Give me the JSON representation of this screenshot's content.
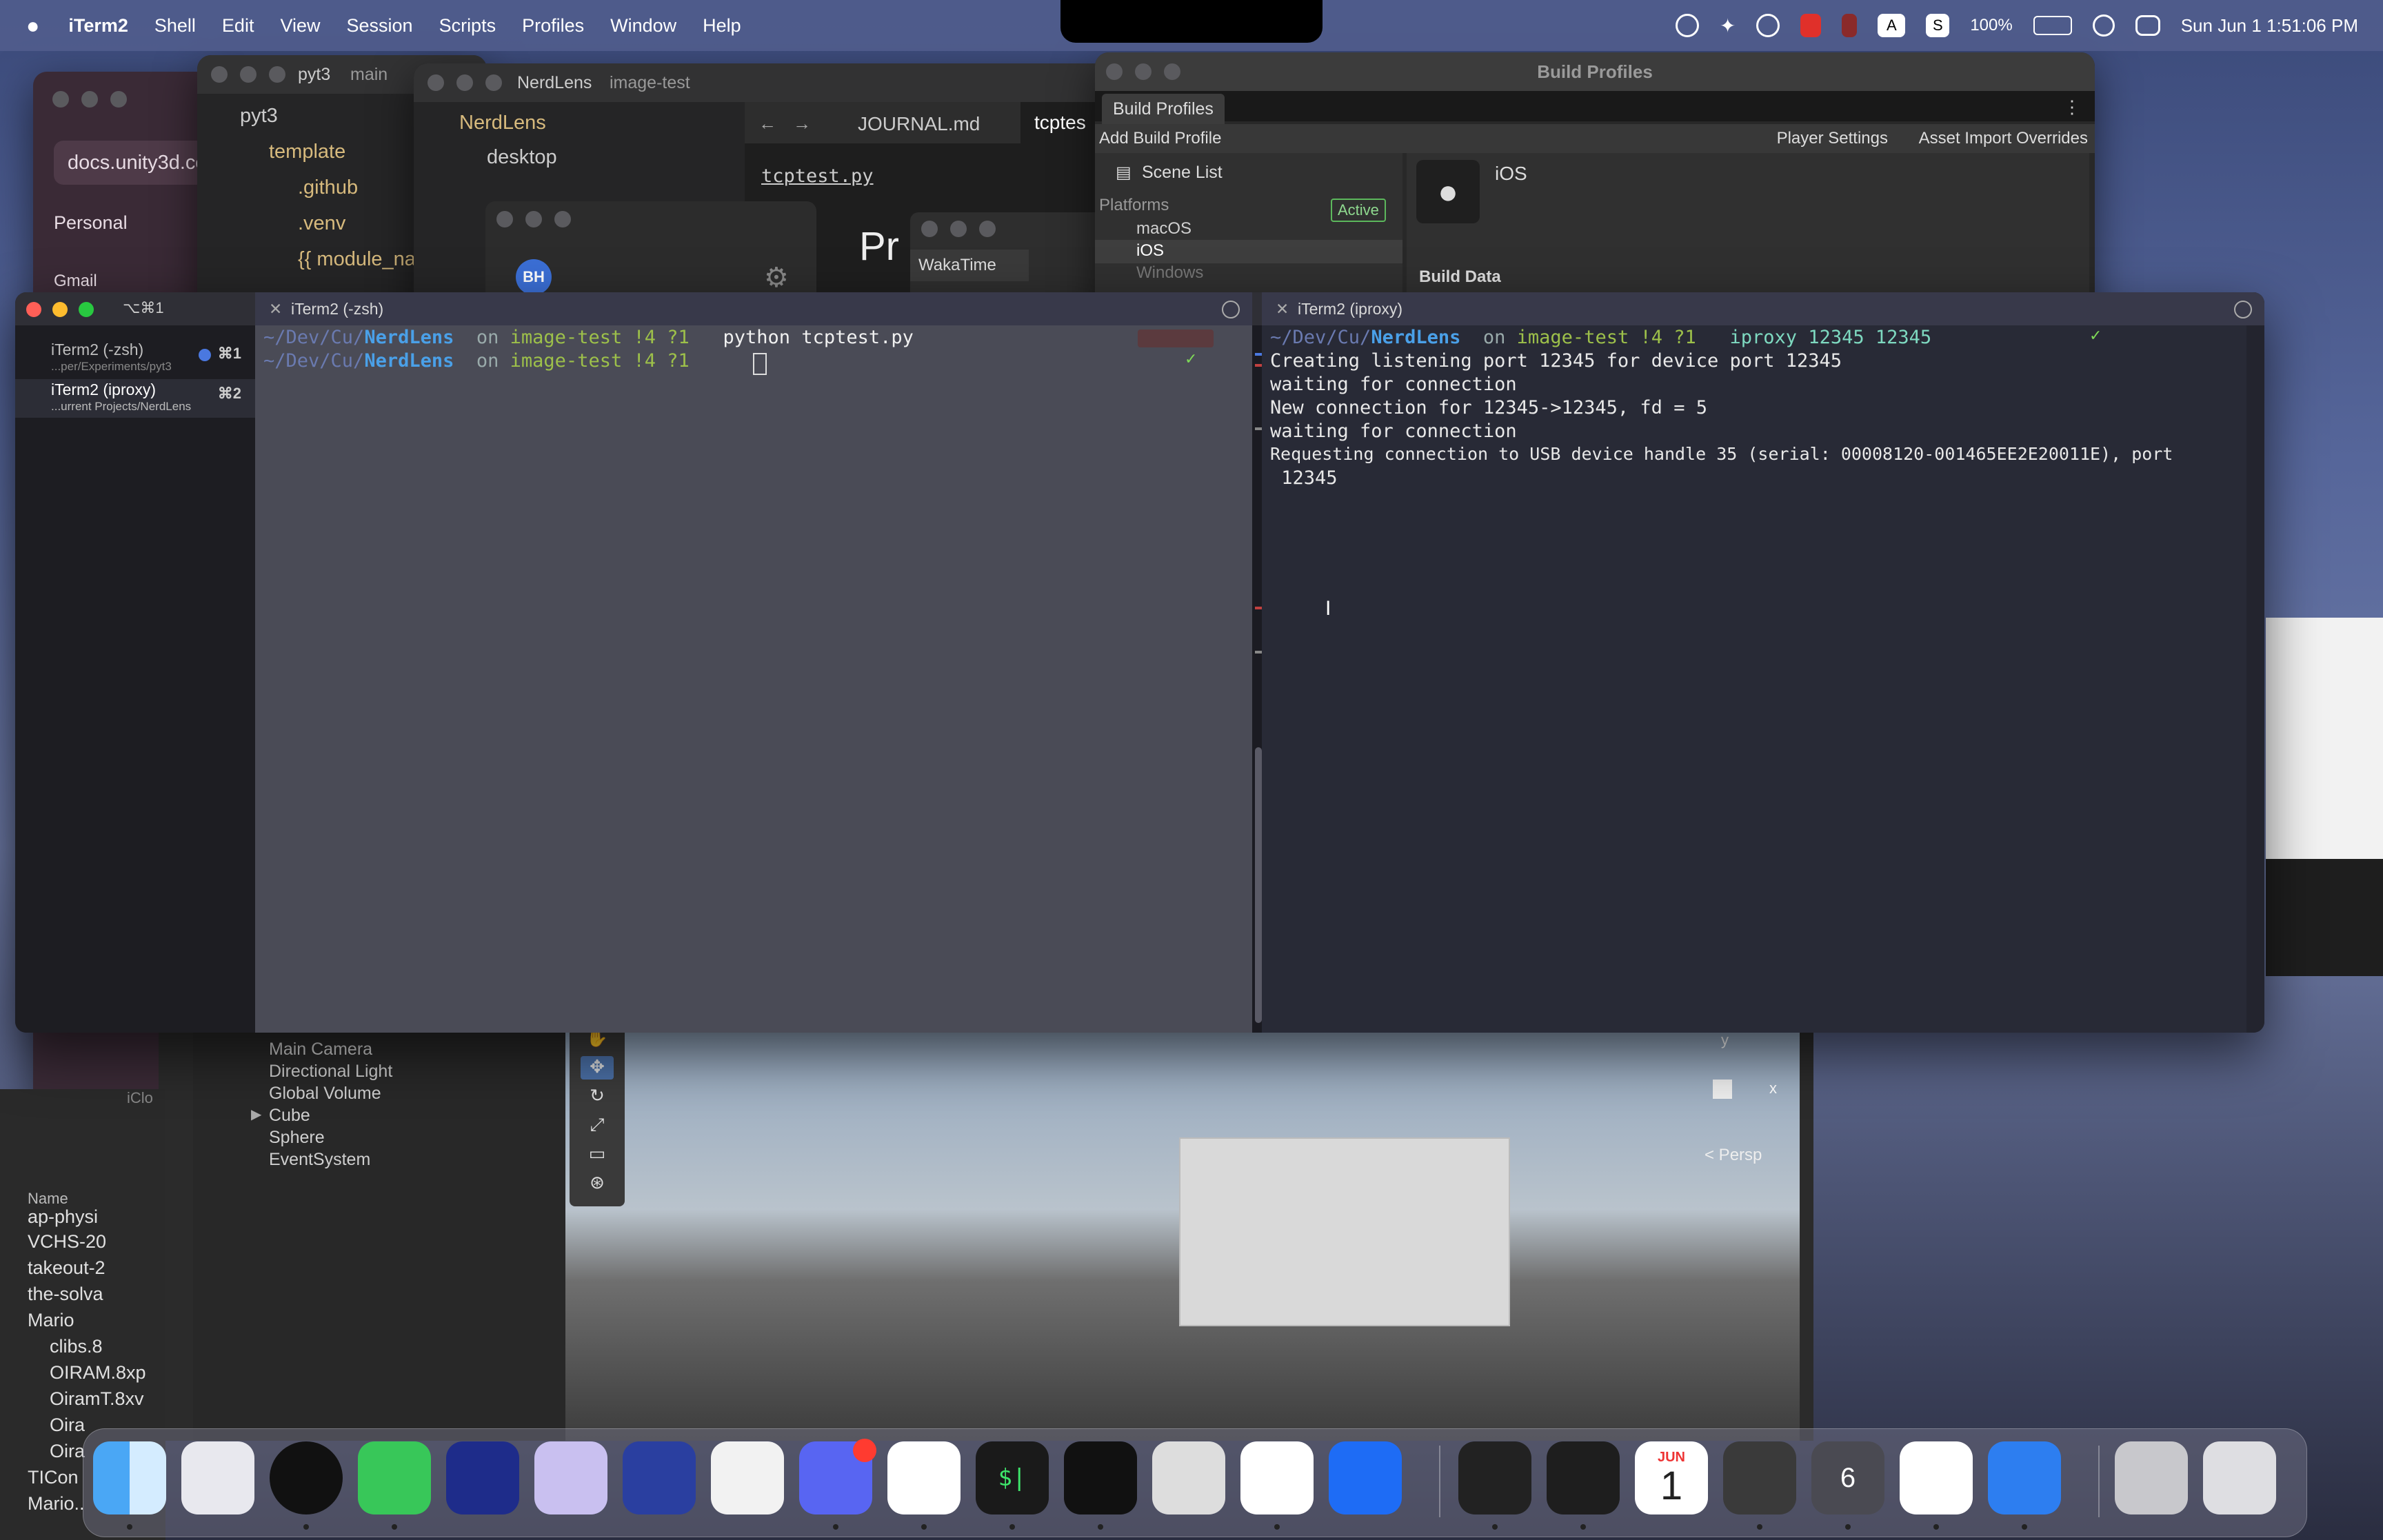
{
  "menubar": {
    "app": "iTerm2",
    "items": [
      "Shell",
      "Edit",
      "View",
      "Session",
      "Scripts",
      "Profiles",
      "Window",
      "Help"
    ],
    "battery": "100%",
    "clock": "Sun Jun 1  1:51:06 PM"
  },
  "browser": {
    "url": "docs.unity3d.co",
    "favorites": [
      "Personal",
      "Gmail"
    ]
  },
  "vscode_pyt3": {
    "title": "pyt3",
    "branch": "main",
    "tree": [
      "pyt3",
      "template",
      ".github",
      ".venv",
      "{{ module_na"
    ]
  },
  "vscode_nerdlens": {
    "title": "NerdLens",
    "branch": "image-test",
    "root": "NerdLens",
    "folder": "desktop",
    "tabs": [
      "JOURNAL.md",
      "tcptes"
    ],
    "file": "tcptest.py",
    "avatar": "BH",
    "partial_heading": "Pr",
    "wakatime": "WakaTime"
  },
  "build_profiles": {
    "title": "Build Profiles",
    "tab": "Build Profiles",
    "add": "Add Build Profile",
    "player_settings": "Player Settings",
    "asset_overrides": "Asset Import Overrides",
    "scene_list": "Scene List",
    "platforms_label": "Platforms",
    "platforms": [
      "macOS",
      "iOS",
      "Windows"
    ],
    "active": "Active",
    "selected_platform": "iOS",
    "build_data": "Build Data"
  },
  "iterm": {
    "window_shortcut": "⌥⌘1",
    "tabs": [
      {
        "title": "iTerm2 (-zsh)",
        "sub": "...per/Experiments/pyt3",
        "shortcut": "⌘1"
      },
      {
        "title": "iTerm2 (iproxy)",
        "sub": "...urrent Projects/NerdLens",
        "shortcut": "⌘2"
      }
    ],
    "left_pane": {
      "title": "iTerm2 (-zsh)",
      "lines": [
        {
          "path": "~/Dev/Cu/",
          "dir": "NerdLens",
          "on": "on",
          "branch": "image-test !4 ?1",
          "cmd": "python tcptest.py"
        },
        {
          "path": "~/Dev/Cu/",
          "dir": "NerdLens",
          "on": "on",
          "branch": "image-test !4 ?1",
          "cmd": "",
          "status": "✓"
        }
      ]
    },
    "right_pane": {
      "title": "iTerm2 (iproxy)",
      "prompt": {
        "path": "~/Dev/Cu/",
        "dir": "NerdLens",
        "on": "on",
        "branch": "image-test !4 ?1",
        "cmd": "iproxy 12345 12345",
        "status": "✓"
      },
      "output": [
        "Creating listening port 12345 for device port 12345",
        "waiting for connection",
        "New connection for 12345->12345, fd = 5",
        "waiting for connection",
        "Requesting connection to USB device handle 35 (serial: 00008120-001465EE2E20011E), port",
        " 12345"
      ]
    }
  },
  "unity_hierarchy": [
    "Main Camera",
    "Directional Light",
    "Global Volume",
    "Cube",
    "Sphere",
    "EventSystem"
  ],
  "unity_scene": {
    "gizmo_y": "y",
    "gizmo_x": "x",
    "persp": "< Persp"
  },
  "finder": {
    "column": "Name",
    "files": [
      "ap-physi",
      "VCHS-20",
      "takeout-2",
      "the-solva",
      "Mario",
      "clibs.8",
      "OIRAM.8xp",
      "OiramT.8xv",
      "Oira",
      "Oira",
      "TICon",
      "Mario.."
    ],
    "sidebar": [
      "iClo"
    ]
  },
  "dock": {
    "apps": [
      "finder-icon",
      "launchpad-icon",
      "chatgpt-ring-icon",
      "messages-icon",
      "scrivener-icon",
      "obsidian-icon",
      "crystal-icon",
      "cube-app-icon",
      "discord-icon",
      "slack-icon",
      "terminal-icon",
      "zed-icon",
      "iphone-mirroring-icon",
      "chatgpt-icon",
      "roblox-icon",
      "obsidian2-icon",
      "figma-icon",
      "calendar-icon",
      "unity-hub-icon",
      "unity6-icon",
      "vscode-icon",
      "xcode-icon",
      "archive-icon",
      "trash-icon"
    ],
    "calendar_month": "JUN",
    "calendar_day": "1",
    "terminal_glyph": "$|",
    "unity_version": "6"
  }
}
